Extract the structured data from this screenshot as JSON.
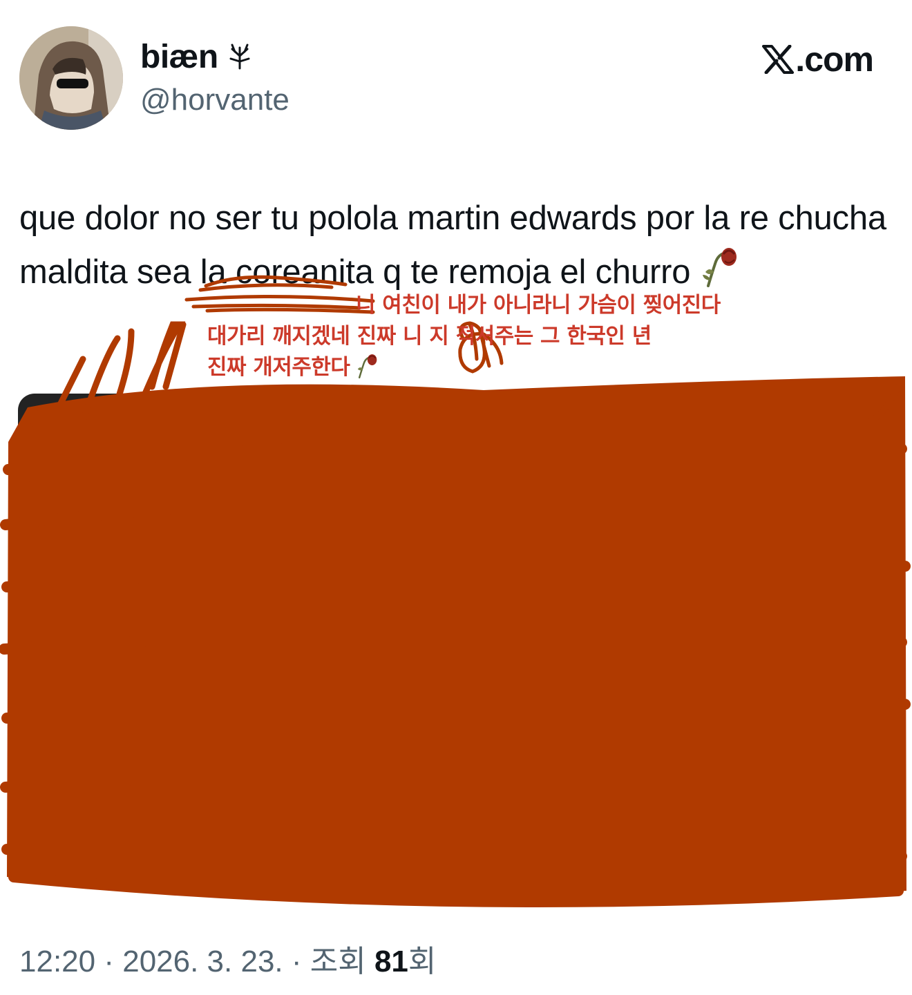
{
  "author": {
    "display_name": "biæn",
    "handle": "@horvante",
    "name_icon": "branch-icon",
    "avatar_icon": "hooded-person-avatar"
  },
  "brand": {
    "logo_icon": "x-logo-icon",
    "domain": ".com"
  },
  "tweet": {
    "text": "que dolor no ser tu polola martin edwards por la re chucha maldita sea la coreanita q te remoja el churro",
    "emoji_icon": "wilted-flower-icon"
  },
  "annotation": {
    "line1": "니 여친이 내가 아니라니 가슴이 찢어진다",
    "line2": "대가리 깨지겠네 진짜 니  지 적셔주는 그 한국인 년",
    "line3": "진짜 개저주한다",
    "color": "#cc3a2a"
  },
  "media": {
    "redaction_color": "#b03a00"
  },
  "meta": {
    "time": "12:20",
    "separator": " · ",
    "date": "2026. 3. 23.",
    "views_prefix": "조회 ",
    "views_count": "81",
    "views_suffix": "회"
  }
}
